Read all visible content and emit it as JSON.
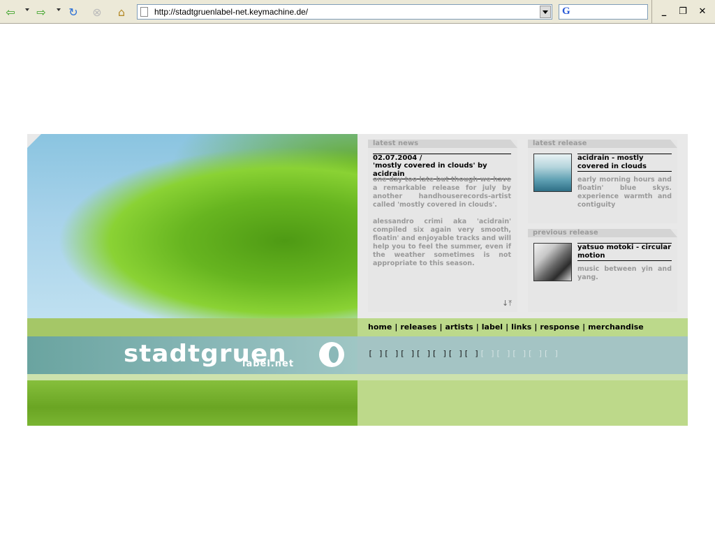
{
  "browser": {
    "url": "http://stadtgruenlabel-net.keymachine.de/",
    "search_value": "",
    "search_engine_glyph": "G",
    "icons": [
      "back-icon",
      "forward-icon",
      "refresh-icon",
      "stop-icon",
      "home-icon"
    ],
    "window": {
      "minimize": "_",
      "restore": "❐",
      "close": "✕"
    }
  },
  "site": {
    "logo": {
      "word": "stadtgruen",
      "sub": "label.net"
    },
    "news": {
      "tab": "latest news",
      "date": "02.07.2004 /",
      "headline": "'mostly covered in clouds' by acidrain",
      "para1": "one day too late but though we have a remarkable release for july by another handhouserecords-artist called 'mostly covered in clouds'.",
      "para2": "alessandro crimi aka 'acidrain' compiled six again very smooth, floatin' and enjoyable tracks and will help you to feel the summer, even if the weather sometimes is not appropriate to this season."
    },
    "latest_release": {
      "tab": "latest release",
      "title": "acidrain - mostly covered in clouds",
      "desc": "early morning hours and floatin' blue skys. experience warmth and contiguity"
    },
    "previous_release": {
      "tab": "previous release",
      "title": "yatsuo motoki - circular motion",
      "desc": "music between yin and yang."
    },
    "nav": [
      "home",
      "releases",
      "artists",
      "label",
      "links",
      "response",
      "merchandise"
    ],
    "nav_sep": "|",
    "dots_dark": "[ ][ ][ ][ ][ ][ ][ ]",
    "dots_light": "[ ][ ][ ][ ][ ]"
  },
  "colors": {
    "accent_green": "#bcd98b",
    "band_blue": "#a4c4c4",
    "panel_gray": "#e6e6e6"
  }
}
